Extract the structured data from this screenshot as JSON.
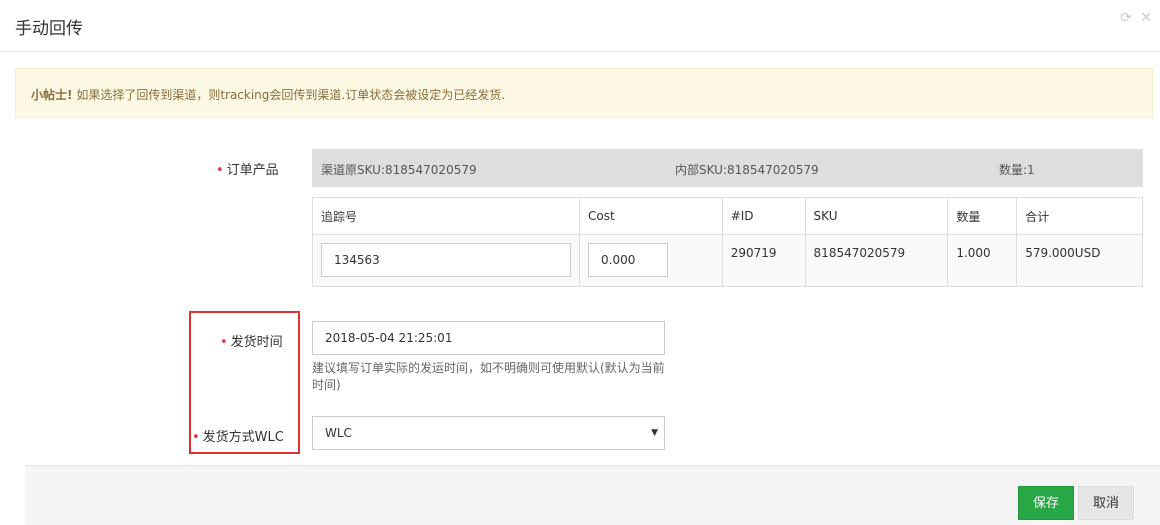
{
  "dialog": {
    "title": "手动回传",
    "refresh_icon": "refresh-icon",
    "close_icon": "close-icon"
  },
  "alert": {
    "tip_label": "小帖士!",
    "message": "如果选择了回传到渠道，则tracking会回传到渠道.订单状态会被设定为已经发货."
  },
  "order_product": {
    "label": "订单产品",
    "channel_sku": "渠道原SKU:818547020579",
    "internal_sku": "内部SKU:818547020579",
    "quantity": "数量:1"
  },
  "items_table": {
    "headers": [
      "追踪号",
      "Cost",
      "#ID",
      "SKU",
      "数量",
      "合计"
    ],
    "row": {
      "tracking_no": "134563",
      "cost": "0.000",
      "id": "290719",
      "sku": "818547020579",
      "qty": "1.000",
      "total": "579.000USD"
    }
  },
  "ship_time": {
    "label": "发货时间",
    "value": "2018-05-04 21:25:01",
    "help": "建议填写订单实际的发运时间，如不明确则可使用默认(默认为当前时间)"
  },
  "ship_method": {
    "label": "发货方式WLC",
    "selected": "WLC"
  },
  "footer": {
    "save_label": "保存",
    "cancel_label": "取消"
  },
  "colors": {
    "save": "#28a745",
    "alert_bg": "#fcf8e3",
    "highlight_box": "#e03131"
  }
}
